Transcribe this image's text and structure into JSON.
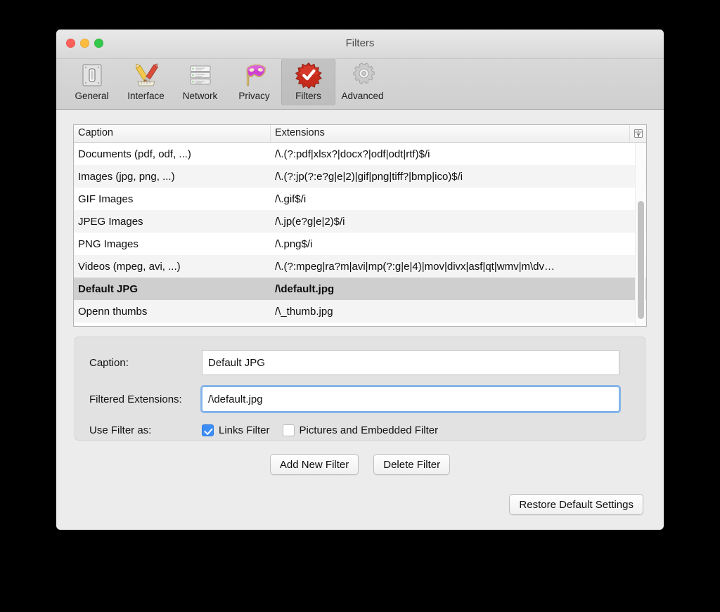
{
  "window": {
    "title": "Filters",
    "traffic_lights": [
      "close",
      "minimize",
      "zoom"
    ]
  },
  "toolbar": {
    "items": [
      {
        "label": "General",
        "icon": "switch-plate-icon",
        "selected": false
      },
      {
        "label": "Interface",
        "icon": "pencil-ruler-brush-icon",
        "selected": false
      },
      {
        "label": "Network",
        "icon": "server-stack-icon",
        "selected": false
      },
      {
        "label": "Privacy",
        "icon": "mask-icon",
        "selected": false
      },
      {
        "label": "Filters",
        "icon": "red-starburst-check-icon",
        "selected": true
      },
      {
        "label": "Advanced",
        "icon": "gear-icon",
        "selected": false
      }
    ]
  },
  "table": {
    "columns": [
      "Caption",
      "Extensions"
    ],
    "corner_icon": "column-options-icon",
    "rows": [
      {
        "caption": "Documents (pdf, odf, ...)",
        "extensions": "/\\.(?:pdf|xlsx?|docx?|odf|odt|rtf)$/i",
        "selected": false
      },
      {
        "caption": "Images (jpg, png, ...)",
        "extensions": "/\\.(?:jp(?:e?g|e|2)|gif|png|tiff?|bmp|ico)$/i",
        "selected": false
      },
      {
        "caption": "GIF Images",
        "extensions": "/\\.gif$/i",
        "selected": false
      },
      {
        "caption": "JPEG Images",
        "extensions": "/\\.jp(e?g|e|2)$/i",
        "selected": false
      },
      {
        "caption": "PNG Images",
        "extensions": "/\\.png$/i",
        "selected": false
      },
      {
        "caption": "Videos (mpeg, avi, ...)",
        "extensions": "/\\.(?:mpeg|ra?m|avi|mp(?:g|e|4)|mov|divx|asf|qt|wmv|m\\dv…",
        "selected": false
      },
      {
        "caption": "Default JPG",
        "extensions": "/\\default.jpg",
        "selected": true
      },
      {
        "caption": "Openn thumbs",
        "extensions": "/\\_thumb.jpg",
        "selected": false
      }
    ]
  },
  "detail": {
    "caption_label": "Caption:",
    "caption_value": "Default JPG",
    "extensions_label": "Filtered Extensions:",
    "extensions_value": "/\\default.jpg",
    "use_filter_label": "Use Filter as:",
    "links_filter_label": "Links Filter",
    "links_filter_checked": true,
    "pictures_filter_label": "Pictures and Embedded Filter",
    "pictures_filter_checked": false
  },
  "buttons": {
    "add_new_filter": "Add New Filter",
    "delete_filter": "Delete Filter",
    "restore_defaults": "Restore Default Settings"
  },
  "colors": {
    "accent": "#3d8ef4",
    "focus_ring": "#7aaee8",
    "window_bg": "#ececec",
    "selected_row": "#cfcfcf"
  }
}
